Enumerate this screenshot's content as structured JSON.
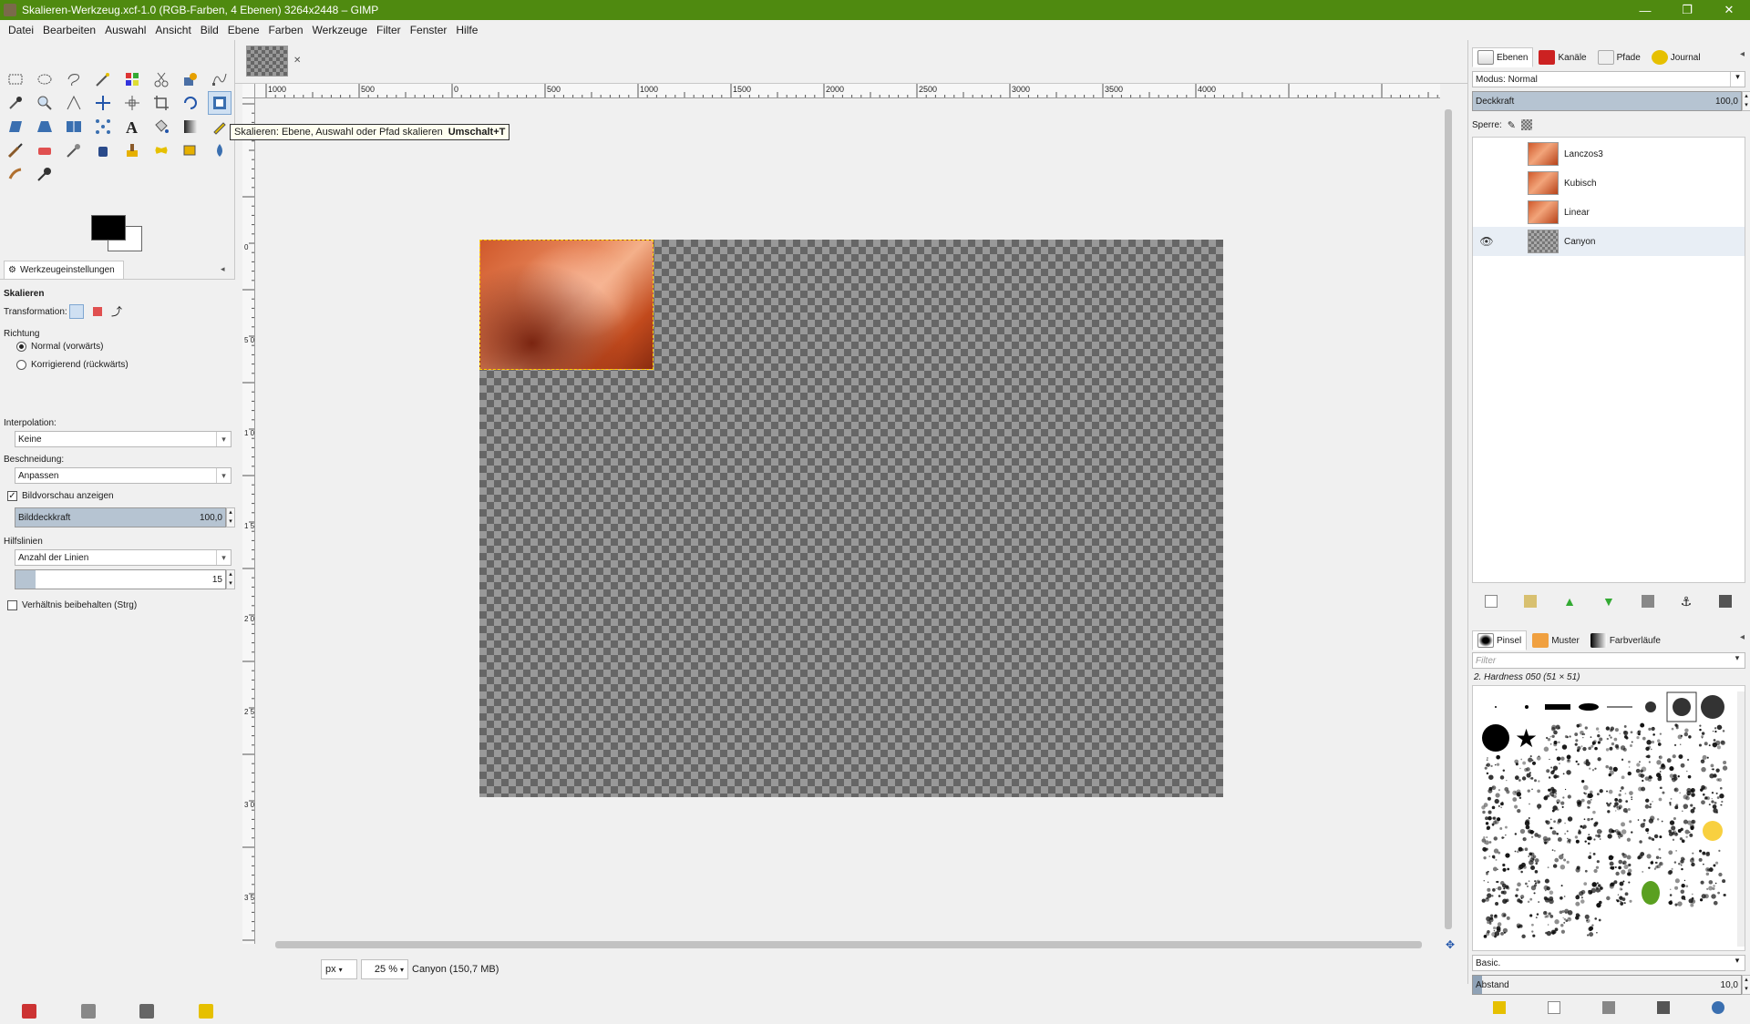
{
  "window": {
    "title": "Skalieren-Werkzeug.xcf-1.0 (RGB-Farben, 4 Ebenen) 3264x2448 – GIMP",
    "minimize": "—",
    "maximize": "❐",
    "close": "✕"
  },
  "menu": [
    "Datei",
    "Bearbeiten",
    "Auswahl",
    "Ansicht",
    "Bild",
    "Ebene",
    "Farben",
    "Werkzeuge",
    "Filter",
    "Fenster",
    "Hilfe"
  ],
  "tooltip": {
    "text": "Skalieren: Ebene, Auswahl oder Pfad skalieren",
    "shortcut": "Umschalt+T"
  },
  "tool_options": {
    "tab_label": "Werkzeugeinstellungen",
    "tool_name": "Skalieren",
    "transformation_label": "Transformation:",
    "direction_label": "Richtung",
    "direction_normal": "Normal (vorwärts)",
    "direction_corrective": "Korrigierend (rückwärts)",
    "interpolation_label": "Interpolation:",
    "interpolation_value": "Keine",
    "clipping_label": "Beschneidung:",
    "clipping_value": "Anpassen",
    "preview_label": "Bildvorschau anzeigen",
    "image_opacity_label": "Bilddeckkraft",
    "image_opacity_value": "100,0",
    "guides_label": "Hilfslinien",
    "guides_value": "Anzahl der Linien",
    "guides_count": "15",
    "keep_aspect_label": "Verhältnis beibehalten (Strg)"
  },
  "ruler": {
    "h_labels": [
      "1000",
      "500",
      "0",
      "500",
      "1000",
      "1500",
      "2000",
      "2500",
      "3000",
      "3500",
      "4000"
    ],
    "v_labels": [
      "0",
      "500",
      "1000",
      "1500",
      "2000",
      "2500",
      "3000",
      "3500"
    ]
  },
  "status": {
    "unit": "px",
    "zoom": "25 %",
    "info": "Canyon (150,7 MB)"
  },
  "layers_dock": {
    "tabs": [
      "Ebenen",
      "Kanäle",
      "Pfade",
      "Journal"
    ],
    "mode_label": "Modus: Normal",
    "opacity_label": "Deckkraft",
    "opacity_value": "100,0",
    "lock_label": "Sperre:",
    "layers": [
      {
        "name": "Lanczos3",
        "visible": false
      },
      {
        "name": "Kubisch",
        "visible": false
      },
      {
        "name": "Linear",
        "visible": false
      },
      {
        "name": "Canyon",
        "visible": true
      }
    ]
  },
  "brushes_dock": {
    "tabs": [
      "Pinsel",
      "Muster",
      "Farbverläufe"
    ],
    "filter_placeholder": "Filter",
    "brush_name": "2. Hardness 050 (51 × 51)",
    "preset": "Basic.",
    "spacing_label": "Abstand",
    "spacing_value": "10,0"
  },
  "colors": {
    "title_bar": "#4f8a10",
    "tooltip_bg": "#fffff0",
    "slider_fill": "#b6c4d2"
  }
}
